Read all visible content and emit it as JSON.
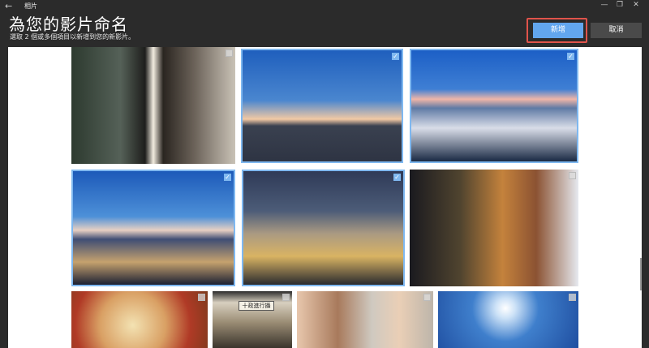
{
  "window": {
    "back_icon": "←",
    "app_title": "相片",
    "controls": [
      "—",
      "❐",
      "✕"
    ]
  },
  "header": {
    "title": "為您的影片命名",
    "subtitle": "選取 2 個或多個項目以新增到您的新影片。"
  },
  "actions": {
    "add_label": "新增",
    "cancel_label": "取消",
    "add_color": "#62a6ee",
    "highlight_color": "#e0534b"
  },
  "gallery": {
    "accent_color": "#7fb8f0",
    "items": [
      {
        "id": "photo-1",
        "selected": false
      },
      {
        "id": "photo-2",
        "selected": true
      },
      {
        "id": "photo-3",
        "selected": true
      },
      {
        "id": "photo-4",
        "selected": true
      },
      {
        "id": "photo-5",
        "selected": true
      },
      {
        "id": "photo-6",
        "selected": false
      },
      {
        "id": "photo-7",
        "selected": false
      },
      {
        "id": "photo-8",
        "selected": false,
        "sign_text": "十政進行攝"
      },
      {
        "id": "photo-9",
        "selected": false
      },
      {
        "id": "photo-10",
        "selected": false
      }
    ]
  }
}
